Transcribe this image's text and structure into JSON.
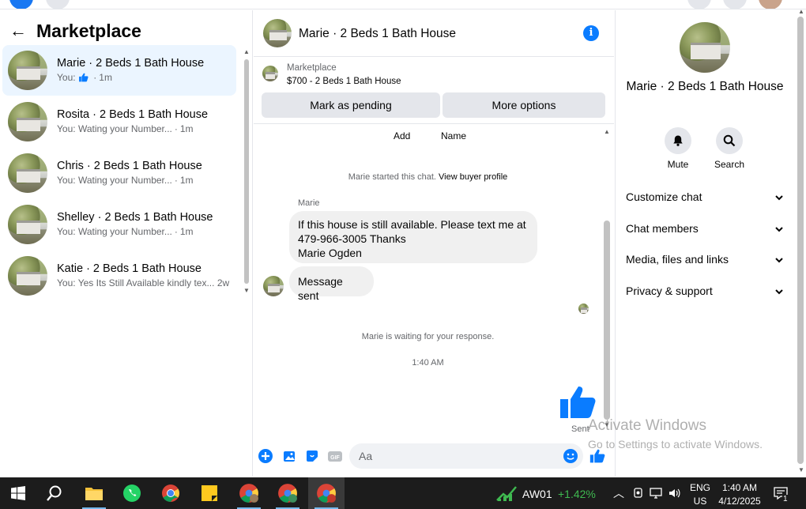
{
  "left": {
    "title": "Marketplace",
    "conversations": [
      {
        "name": "Marie · 2 Beds 1 Bath House",
        "prefix": "You:",
        "snippet": "",
        "time": "1m"
      },
      {
        "name": "Rosita · 2 Beds 1 Bath House",
        "prefix": "You:",
        "snippet": "Wating your Number...",
        "time": "1m"
      },
      {
        "name": "Chris · 2 Beds 1 Bath House",
        "prefix": "You:",
        "snippet": "Wating your Number...",
        "time": "1m"
      },
      {
        "name": "Shelley · 2 Beds 1 Bath House",
        "prefix": "You:",
        "snippet": "Wating your Number...",
        "time": "1m"
      },
      {
        "name": "Katie · 2 Beds 1 Bath House",
        "prefix": "You:",
        "snippet": "Yes Its Still Available kindly tex...",
        "time": "2w"
      }
    ]
  },
  "chat": {
    "title": "Marie · 2 Beds 1 Bath House",
    "marketplace_label": "Marketplace",
    "listing": "$700 - 2 Beds 1 Bath House",
    "mark_pending": "Mark as pending",
    "more_options": "More options",
    "quick_add": "Add",
    "quick_name": "Name",
    "started": "Marie started this chat.",
    "view_profile": "View buyer profile",
    "sender": "Marie",
    "message_lines": [
      "If this house is still available.  Please text me at",
      "479-966-3005  Thanks",
      "Marie Ogden"
    ],
    "message_sent": "Message sent",
    "waiting": "Marie is waiting for your response.",
    "time": "1:40 AM",
    "sent_label": "Sent",
    "input_placeholder": "Aa"
  },
  "right": {
    "title": "Marie · 2 Beds 1 Bath House",
    "mute": "Mute",
    "search": "Search",
    "sections": [
      "Customize chat",
      "Chat members",
      "Media, files and links",
      "Privacy & support"
    ]
  },
  "watermark": {
    "line1": "Activate Windows",
    "line2": "Go to Settings to activate Windows."
  },
  "taskbar": {
    "stock_name": "AW01",
    "stock_change": "+1.42%",
    "lang1": "ENG",
    "lang2": "US",
    "time": "1:40 AM",
    "date": "4/12/2025",
    "notifications": "1"
  },
  "colors": {
    "accent": "#0a7cff",
    "active_row": "#ebf5ff",
    "button_bg": "#e4e6eb"
  }
}
